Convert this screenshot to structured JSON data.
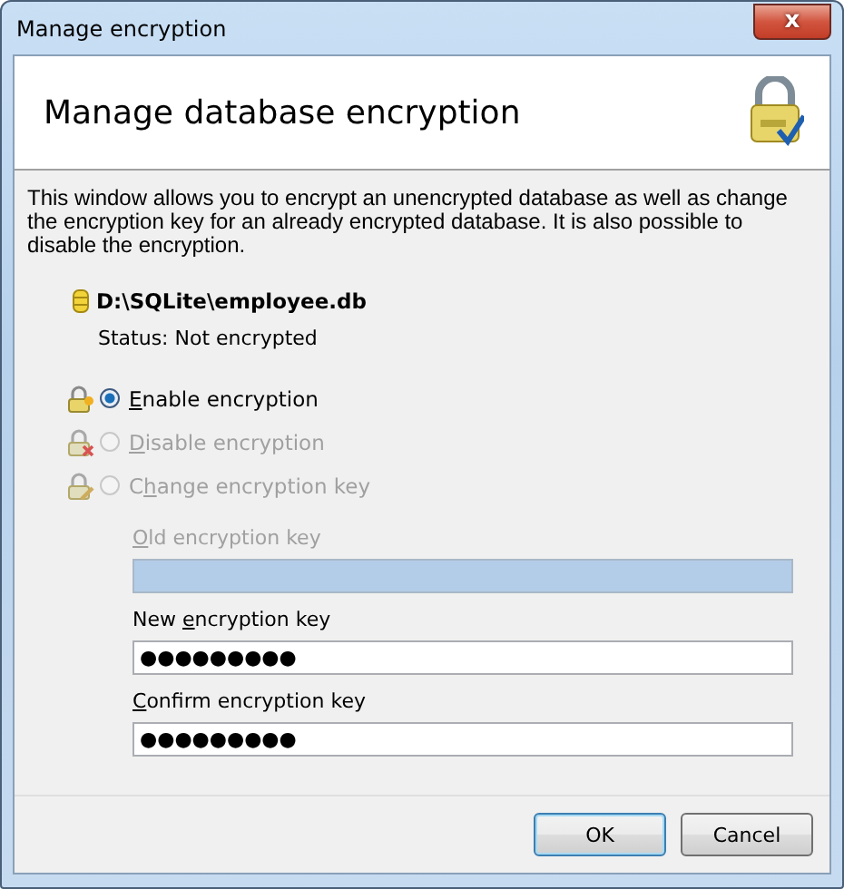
{
  "window": {
    "title": "Manage encryption",
    "close": "x"
  },
  "header": {
    "title": "Manage database encryption"
  },
  "description": "This window allows you to encrypt an unencrypted database as well as change the encryption key for an already encrypted database. It is also possible to disable the encryption.",
  "database": {
    "path": "D:\\SQLite\\employee.db",
    "status": "Status: Not encrypted"
  },
  "options": [
    {
      "key": "E",
      "post": "nable encryption",
      "selected": true,
      "disabled": false
    },
    {
      "key": "D",
      "post": "isable encryption",
      "selected": false,
      "disabled": true
    },
    {
      "pre": "C",
      "key": "h",
      "post": "ange encryption key",
      "selected": false,
      "disabled": true
    }
  ],
  "fields": [
    {
      "key": "O",
      "post": "ld encryption key",
      "disabled": true
    },
    {
      "pre": "New ",
      "key": "e",
      "post": "ncryption key",
      "value": "●●●●●●●●●",
      "disabled": false
    },
    {
      "key": "C",
      "post": "onfirm encryption key",
      "value": "●●●●●●●●●",
      "disabled": false
    }
  ],
  "buttons": [
    {
      "label": "OK",
      "default": true
    },
    {
      "label": "Cancel",
      "default": false
    }
  ]
}
